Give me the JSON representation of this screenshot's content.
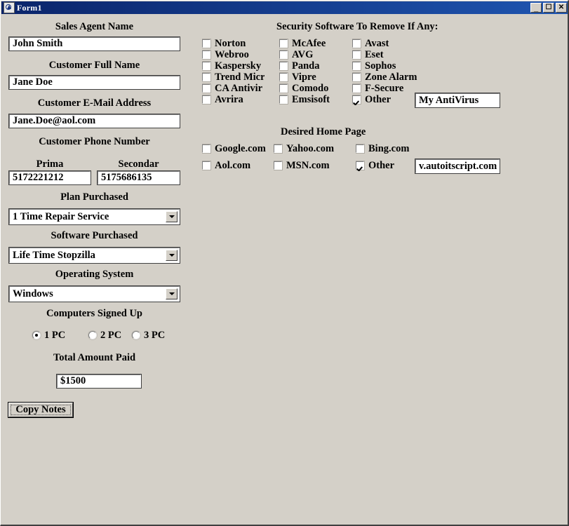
{
  "window": {
    "title": "Form1",
    "icon": "autoit-icon",
    "buttons": {
      "minimize": "_",
      "maximize": "❐",
      "close": "✕"
    },
    "colors": {
      "titlebar_start": "#0a246a",
      "titlebar_end": "#1f55b0",
      "client_background": "#d4d0c8",
      "field_background": "#ffffff",
      "text": "#000000"
    }
  },
  "left_panel": {
    "sales_agent": {
      "label": "Sales Agent Name",
      "value": "John Smith"
    },
    "customer_name": {
      "label": "Customer Full Name",
      "value": "Jane Doe"
    },
    "customer_email": {
      "label": "Customer E-Mail Address",
      "value": "Jane.Doe@aol.com"
    },
    "phone": {
      "group_label": "Customer Phone Number",
      "primary": {
        "label": "Prima",
        "value": "5172221212"
      },
      "secondary": {
        "label": "Secondar",
        "value": "5175686135"
      }
    },
    "plan_purchased": {
      "label": "Plan Purchased",
      "selected": "1 Time Repair Service"
    },
    "software_purchased": {
      "label": "Software Purchased",
      "selected": "Life Time Stopzilla"
    },
    "operating_system": {
      "label": "Operating System",
      "selected": "Windows"
    },
    "computers_signed_up": {
      "label": "Computers Signed Up",
      "options": [
        {
          "label": "1 PC",
          "selected": true
        },
        {
          "label": "2 PC",
          "selected": false
        },
        {
          "label": "3 PC",
          "selected": false
        }
      ]
    },
    "total_amount_paid": {
      "label": "Total Amount Paid",
      "value": "$1500"
    },
    "copy_notes_button": "Copy Notes"
  },
  "security_software": {
    "heading": "Security Software To Remove If Any:",
    "column1": [
      {
        "label": "Norton",
        "checked": false
      },
      {
        "label": "Webroo",
        "checked": false
      },
      {
        "label": "Kaspersky",
        "checked": false
      },
      {
        "label": "Trend Micr",
        "checked": false
      },
      {
        "label": "CA Antivir",
        "checked": false
      },
      {
        "label": "Avrira",
        "checked": false
      }
    ],
    "column2": [
      {
        "label": "McAfee",
        "checked": false
      },
      {
        "label": "AVG",
        "checked": false
      },
      {
        "label": "Panda",
        "checked": false
      },
      {
        "label": "Vipre",
        "checked": false
      },
      {
        "label": "Comodo",
        "checked": false
      },
      {
        "label": "Emsisoft",
        "checked": false
      }
    ],
    "column3": [
      {
        "label": "Avast",
        "checked": false
      },
      {
        "label": "Eset",
        "checked": false
      },
      {
        "label": "Sophos",
        "checked": false
      },
      {
        "label": "Zone Alarm",
        "checked": false
      },
      {
        "label": "F-Secure",
        "checked": false
      },
      {
        "label": "Other",
        "checked": true
      }
    ],
    "other_value": "My AntiVirus"
  },
  "home_page": {
    "heading": "Desired Home Page",
    "options": [
      {
        "label": "Google.com",
        "checked": false
      },
      {
        "label": "Yahoo.com",
        "checked": false
      },
      {
        "label": "Bing.com",
        "checked": false
      },
      {
        "label": "Aol.com",
        "checked": false
      },
      {
        "label": "MSN.com",
        "checked": false
      },
      {
        "label": "Other",
        "checked": true
      }
    ],
    "other_value": "v.autoitscript.com"
  }
}
